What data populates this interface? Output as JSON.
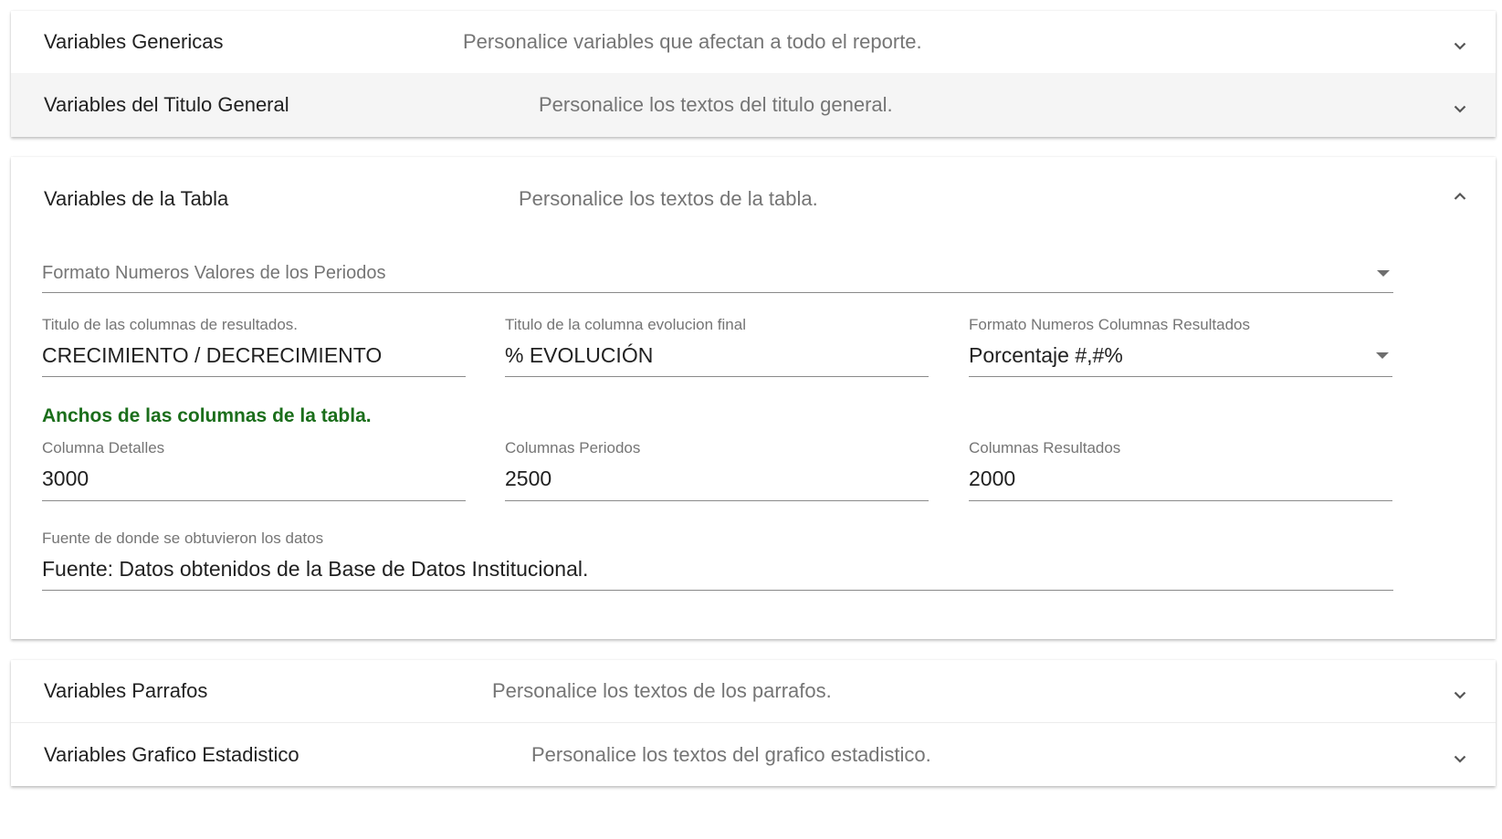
{
  "panels": {
    "genericas": {
      "title": "Variables Genericas",
      "description": "Personalice variables que afectan a todo el reporte."
    },
    "titulo_general": {
      "title": "Variables del Titulo General",
      "description": "Personalice los textos del titulo general."
    },
    "tabla": {
      "title": "Variables de la Tabla",
      "description": "Personalice los textos de la tabla.",
      "format_periods": {
        "placeholder": "Formato Numeros Valores de los Periodos"
      },
      "results_title": {
        "label": "Titulo de las columnas de resultados.",
        "value": "CRECIMIENTO / DECRECIMIENTO"
      },
      "evolution_title": {
        "label": "Titulo de la columna evolucion final",
        "value": "% EVOLUCIÓN"
      },
      "results_format": {
        "label": "Formato Numeros Columnas Resultados",
        "value": "Porcentaje #,#%"
      },
      "widths_heading": "Anchos de las columnas de la tabla.",
      "col_detalles": {
        "label": "Columna Detalles",
        "value": "3000"
      },
      "col_periodos": {
        "label": "Columnas Periodos",
        "value": "2500"
      },
      "col_resultados": {
        "label": "Columnas Resultados",
        "value": "2000"
      },
      "source": {
        "label": "Fuente de donde se obtuvieron los datos",
        "value": "Fuente: Datos obtenidos de la Base de Datos Institucional."
      }
    },
    "parrafos": {
      "title": "Variables Parrafos",
      "description": "Personalice los textos de los parrafos."
    },
    "grafico": {
      "title": "Variables Grafico Estadistico",
      "description": "Personalice los textos del grafico estadistico."
    }
  },
  "icons": {
    "collapsed": "chevron-down-icon",
    "expanded": "chevron-up-icon",
    "select": "arrow-drop-down-icon"
  },
  "colors": {
    "section_heading": "#1b6e1b",
    "header_shaded": "#f5f5f5",
    "secondary_text": "#757575"
  }
}
